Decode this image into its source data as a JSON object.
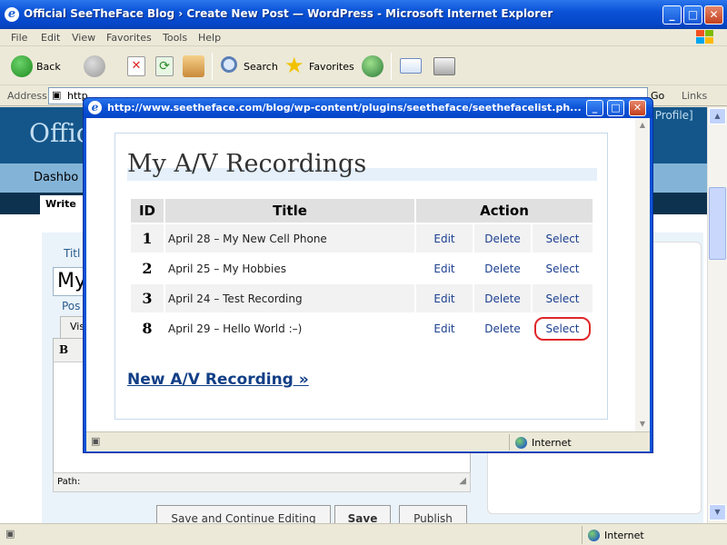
{
  "browser": {
    "title": "Official SeeTheFace Blog › Create New Post — WordPress - Microsoft Internet Explorer",
    "menu": [
      "File",
      "Edit",
      "View",
      "Favorites",
      "Tools",
      "Help"
    ],
    "toolbar": {
      "back": "Back",
      "search": "Search",
      "favorites": "Favorites"
    },
    "address_label": "Address",
    "address_value": "http",
    "go": "Go",
    "links": "Links",
    "status_zone": "Internet"
  },
  "wp": {
    "blog_name": "Offic",
    "profile": "r Profile]",
    "nav_item": "Dashbo",
    "tab": "Write",
    "title_label": "Titl",
    "title_value": "My",
    "post_label": "Pos",
    "visual_tab": "Vis",
    "editor_bold": "B",
    "path_label": "Path:",
    "buttons": [
      "Save and Continue Editing",
      "Save",
      "Publish"
    ]
  },
  "popup": {
    "title": "http://www.seetheface.com/blog/wp-content/plugins/seetheface/seethefacelist.ph...",
    "status_zone": "Internet",
    "heading": "My A/V Recordings",
    "columns": [
      "ID",
      "Title",
      "Action"
    ],
    "rows": [
      {
        "id": "1",
        "title": "April 28 – My New Cell Phone",
        "edit": "Edit",
        "delete": "Delete",
        "select": "Select"
      },
      {
        "id": "2",
        "title": "April 25 – My Hobbies",
        "edit": "Edit",
        "delete": "Delete",
        "select": "Select"
      },
      {
        "id": "3",
        "title": "April 24 – Test Recording",
        "edit": "Edit",
        "delete": "Delete",
        "select": "Select"
      },
      {
        "id": "8",
        "title": "April 29 – Hello World :–)",
        "edit": "Edit",
        "delete": "Delete",
        "select": "Select"
      }
    ],
    "new_link": "New A/V Recording »"
  },
  "colors": {
    "xp_title_blue": "#0a52d6",
    "wp_header": "#14568a",
    "wp_nav": "#83b4d8",
    "link_blue": "#1c3f8f",
    "highlight_red": "#e0262a"
  },
  "icons": [
    "ie-logo-icon",
    "back-icon",
    "forward-icon",
    "stop-icon",
    "refresh-icon",
    "home-icon",
    "search-icon",
    "favorites-star-icon",
    "history-icon",
    "mail-icon",
    "print-icon",
    "globe-icon",
    "windows-logo-icon"
  ]
}
